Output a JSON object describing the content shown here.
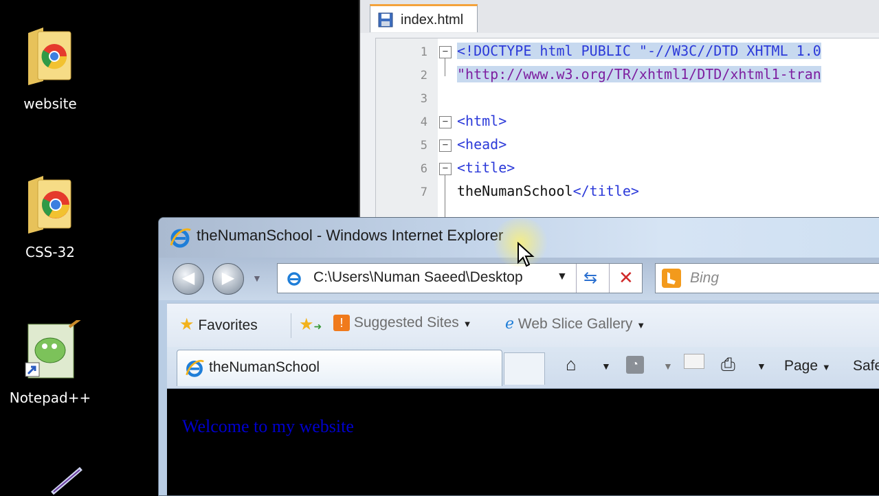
{
  "desktop": {
    "icons": [
      {
        "label": "website"
      },
      {
        "label": "CSS-32"
      },
      {
        "label": "Notepad++"
      }
    ]
  },
  "notepad": {
    "tab_label": "index.html",
    "lines": [
      {
        "num": "1",
        "code": "<!DOCTYPE html PUBLIC \"-//W3C//DTD XHTML 1.0"
      },
      {
        "num": "2",
        "code": "\"http://www.w3.org/TR/xhtml1/DTD/xhtml1-tran"
      },
      {
        "num": "3",
        "code": ""
      },
      {
        "num": "4",
        "code": "<html>"
      },
      {
        "num": "5",
        "code": "<head>"
      },
      {
        "num": "6",
        "code": "<title>"
      },
      {
        "num": "7",
        "code_text": "theNumanSchool",
        "code_tag": "</title>"
      }
    ]
  },
  "ie": {
    "title": "theNumanSchool - Windows Internet Explorer",
    "address": "C:\\Users\\Numan Saeed\\Desktop",
    "search_placeholder": "Bing",
    "favorites": {
      "favorites_label": "Favorites",
      "suggested_label": "Suggested Sites",
      "webslice_label": "Web Slice Gallery"
    },
    "tab_label": "theNumanSchool",
    "commands": {
      "page_label": "Page",
      "safety_label": "Safe"
    },
    "content_text": "Welcome to my website"
  }
}
